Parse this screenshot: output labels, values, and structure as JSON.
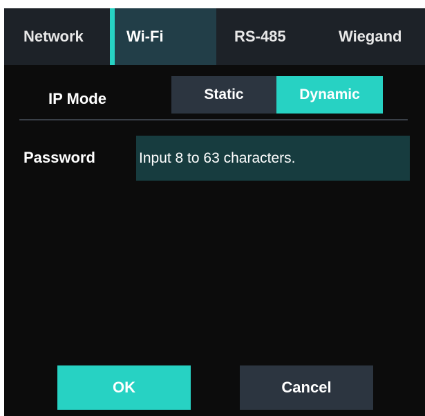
{
  "tabs": [
    {
      "label": "Network",
      "active": false
    },
    {
      "label": "Wi-Fi",
      "active": true
    },
    {
      "label": "RS-485",
      "active": false
    },
    {
      "label": "Wiegand",
      "active": false
    }
  ],
  "ip_mode": {
    "label": "IP Mode",
    "options": [
      "Static",
      "Dynamic"
    ],
    "selected": "Dynamic"
  },
  "password": {
    "label": "Password",
    "value": "",
    "placeholder": "Input 8 to 63 characters."
  },
  "buttons": {
    "ok_label": "OK",
    "cancel_label": "Cancel"
  },
  "colors": {
    "accent": "#27d2c3",
    "background": "#0c0c0c",
    "tabbar": "#1d2228",
    "active_tab": "#223e48",
    "inactive_button": "#2c3540",
    "input_background": "#173c3f"
  }
}
